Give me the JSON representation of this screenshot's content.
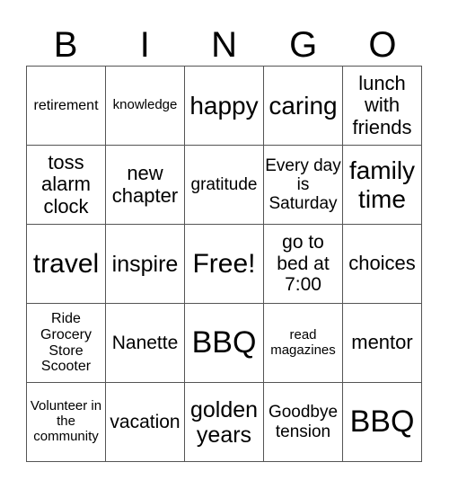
{
  "header": {
    "letters": [
      "B",
      "I",
      "N",
      "G",
      "O"
    ]
  },
  "grid": [
    [
      "retirement",
      "knowledge",
      "happy",
      "caring",
      "lunch with friends"
    ],
    [
      "toss alarm clock",
      "new chapter",
      "gratitude",
      "Every day is Saturday",
      "family time"
    ],
    [
      "travel",
      "inspire",
      "Free!",
      "go to bed at 7:00",
      "choices"
    ],
    [
      "Ride Grocery Store Scooter",
      "Nanette",
      "BBQ",
      "read magazines",
      "mentor"
    ],
    [
      "Volunteer in the community",
      "vacation",
      "golden years",
      "Goodbye tension",
      "BBQ"
    ]
  ]
}
